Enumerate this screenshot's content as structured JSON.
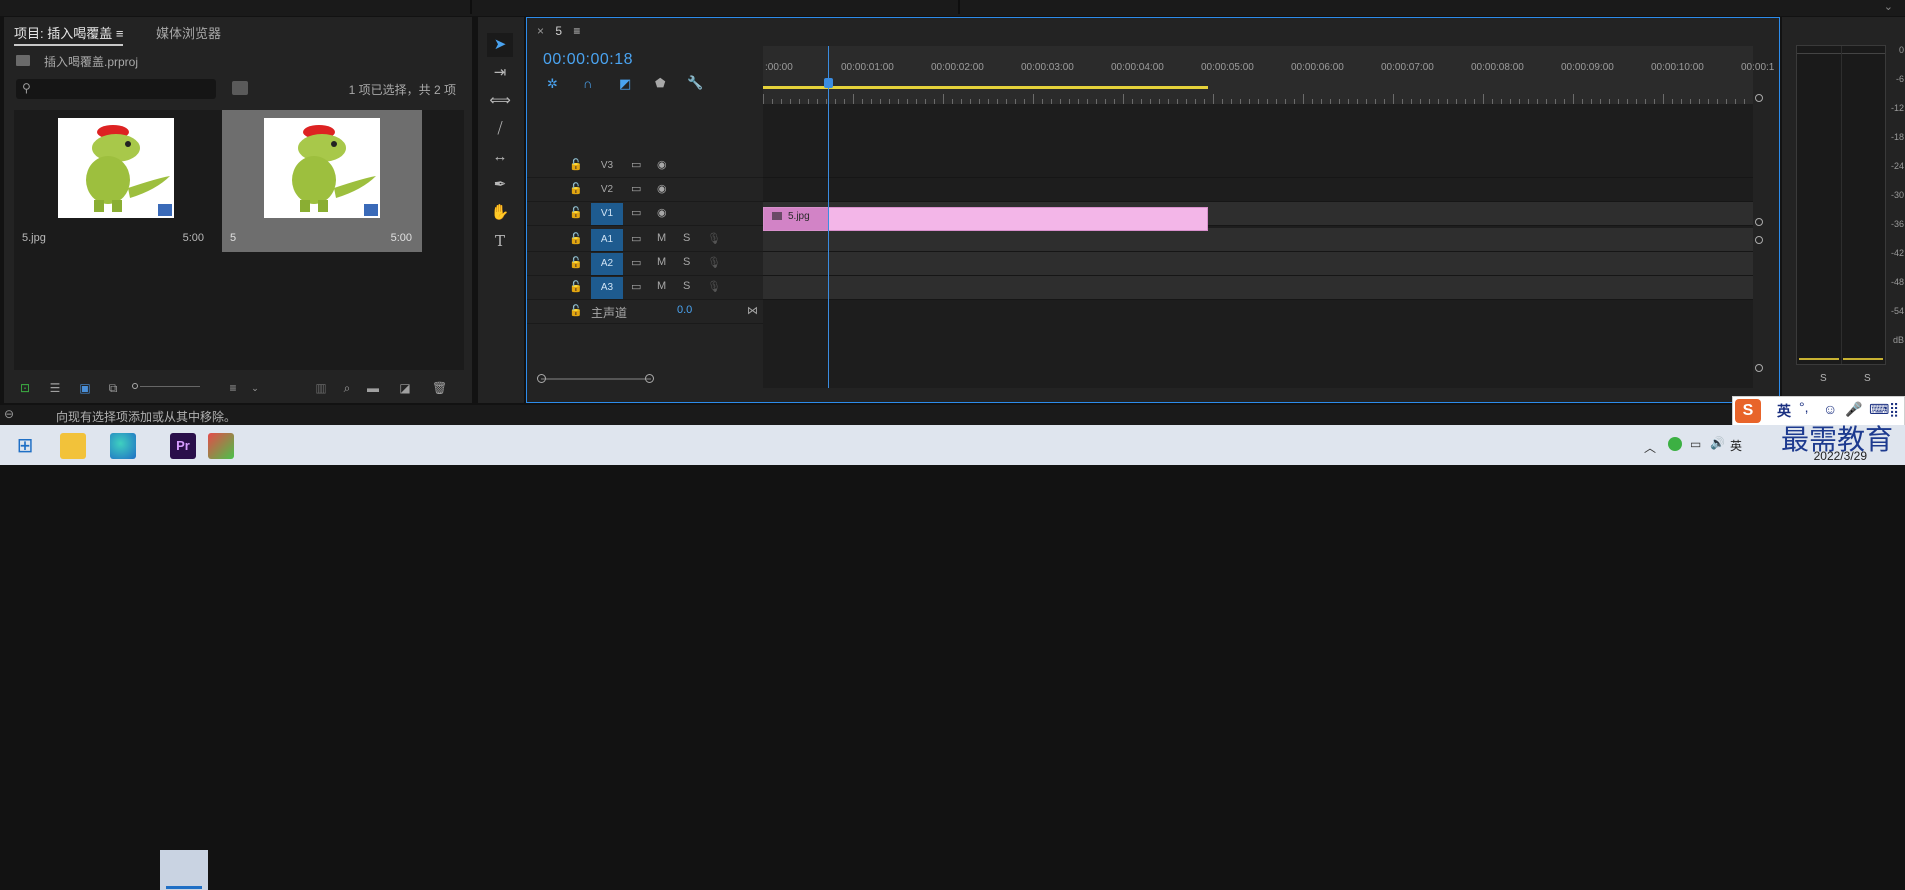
{
  "project_panel": {
    "tab_project": "项目: 插入喝覆盖",
    "tab_menu": "≡",
    "tab_media": "媒体浏览器",
    "project_file": "插入喝覆盖.prproj",
    "selection_count": "1 项已选择，共 2 项",
    "items": [
      {
        "name": "5.jpg",
        "duration": "5:00"
      },
      {
        "name": "5",
        "duration": "5:00"
      }
    ]
  },
  "timeline": {
    "tab_close": "×",
    "tab_name": "5",
    "tab_menu": "≡",
    "timecode": "00:00:00:18",
    "ruler_labels": [
      ":00:00",
      "00:00:01:00",
      "00:00:02:00",
      "00:00:03:00",
      "00:00:04:00",
      "00:00:05:00",
      "00:00:06:00",
      "00:00:07:00",
      "00:00:08:00",
      "00:00:09:00",
      "00:00:10:00",
      "00:00:1"
    ],
    "tracks": [
      {
        "name": "V3",
        "kind": "video",
        "target": false
      },
      {
        "name": "V2",
        "kind": "video",
        "target": false
      },
      {
        "name": "V1",
        "kind": "video",
        "target": true
      },
      {
        "name": "A1",
        "kind": "audio",
        "target": true
      },
      {
        "name": "A2",
        "kind": "audio",
        "target": true
      },
      {
        "name": "A3",
        "kind": "audio",
        "target": true
      }
    ],
    "master_label": "主声道",
    "master_value": "0.0",
    "mute_label": "M",
    "solo_label": "S",
    "clip_name": "5.jpg"
  },
  "meters": {
    "db_labels": [
      "0",
      "-6",
      "-12",
      "-18",
      "-24",
      "-30",
      "-36",
      "-42",
      "-48",
      "-54",
      "dB"
    ],
    "solo_left": "S",
    "solo_right": "S"
  },
  "status": {
    "text": "向现有选择项添加或从其中移除。"
  },
  "taskbar": {
    "date": "2022/3/29",
    "ime_lang": "英",
    "tray_lang": "英"
  },
  "watermark": "最需教育",
  "colors": {
    "accent_blue": "#2d8ceb",
    "clip_pink": "#f3b6e8",
    "track_target": "#1e5b8f",
    "workarea_yellow": "#e6d23a"
  }
}
